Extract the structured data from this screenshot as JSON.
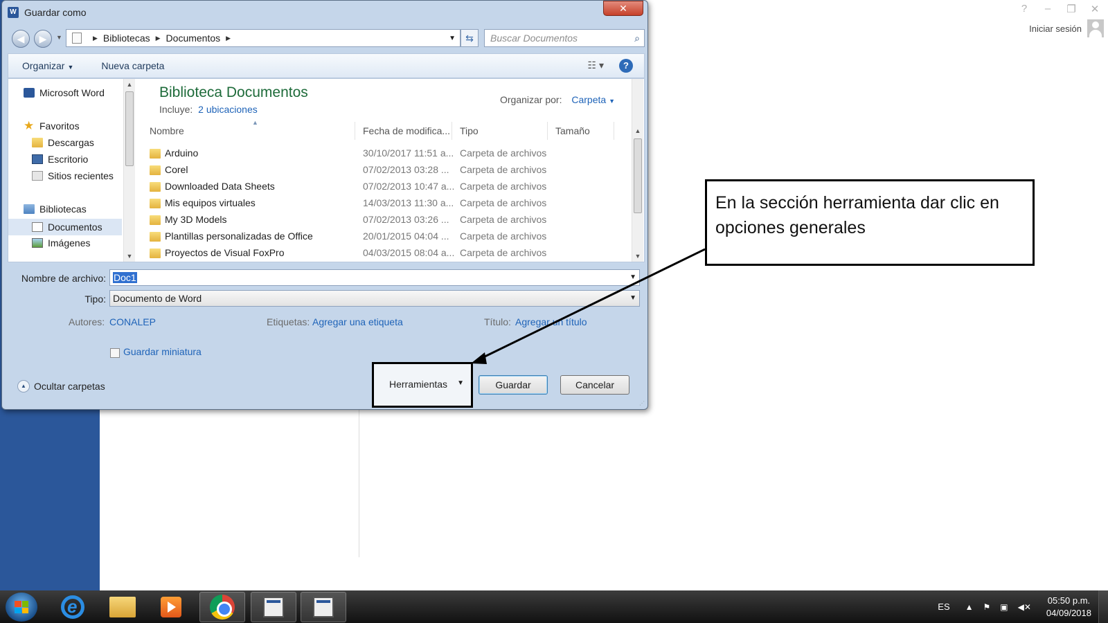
{
  "window": {
    "controls": [
      "?",
      "–",
      "❐",
      "✕"
    ],
    "signin_label": "Iniciar sesión"
  },
  "dialog": {
    "title": "Guardar como",
    "app_icon_letter": "W",
    "close_glyph": "✕",
    "address": {
      "crumbs": [
        "Bibliotecas",
        "Documentos"
      ]
    },
    "search": {
      "placeholder": "Buscar Documentos"
    },
    "toolbar": {
      "organize_label": "Organizar",
      "new_folder_label": "Nueva carpeta",
      "help_glyph": "?"
    },
    "nav_pane": {
      "items": [
        {
          "label": "Microsoft Word",
          "icon": "word-icon"
        },
        {
          "label": "Favoritos",
          "icon": "star-icon"
        },
        {
          "label": "Descargas",
          "icon": "downloads-folder-icon"
        },
        {
          "label": "Escritorio",
          "icon": "desktop-icon"
        },
        {
          "label": "Sitios recientes",
          "icon": "recent-places-icon"
        },
        {
          "label": "Bibliotecas",
          "icon": "libraries-icon"
        },
        {
          "label": "Documentos",
          "icon": "documents-icon",
          "selected": true
        },
        {
          "label": "Imágenes",
          "icon": "pictures-icon"
        }
      ]
    },
    "library": {
      "title": "Biblioteca Documentos",
      "includes_label": "Incluye:",
      "includes_link": "2 ubicaciones",
      "arrange_label": "Organizar por:",
      "arrange_value": "Carpeta"
    },
    "file_list": {
      "columns": [
        "Nombre",
        "Fecha de modifica...",
        "Tipo",
        "Tamaño"
      ],
      "rows": [
        {
          "name": "Arduino",
          "date": "30/10/2017 11:51 a...",
          "type": "Carpeta de archivos"
        },
        {
          "name": "Corel",
          "date": "07/02/2013 03:28 ...",
          "type": "Carpeta de archivos"
        },
        {
          "name": "Downloaded Data Sheets",
          "date": "07/02/2013 10:47 a...",
          "type": "Carpeta de archivos"
        },
        {
          "name": "Mis equipos virtuales",
          "date": "14/03/2013 11:30 a...",
          "type": "Carpeta de archivos"
        },
        {
          "name": "My 3D Models",
          "date": "07/02/2013 03:26 ...",
          "type": "Carpeta de archivos"
        },
        {
          "name": "Plantillas personalizadas de Office",
          "date": "20/01/2015 04:04 ...",
          "type": "Carpeta de archivos"
        },
        {
          "name": "Proyectos de Visual FoxPro",
          "date": "04/03/2015 08:04 a...",
          "type": "Carpeta de archivos"
        }
      ]
    },
    "filename": {
      "label": "Nombre de archivo:",
      "value": "Doc1"
    },
    "filetype": {
      "label": "Tipo:",
      "value": "Documento de Word"
    },
    "meta": {
      "authors_label": "Autores:",
      "authors_value": "CONALEP",
      "tags_label": "Etiquetas:",
      "tags_value": "Agregar una etiqueta",
      "title_label": "Título:",
      "title_value": "Agregar un título"
    },
    "thumbnail_label": "Guardar miniatura",
    "hide_folders_label": "Ocultar carpetas",
    "tools_label": "Herramientas",
    "save_label": "Guardar",
    "cancel_label": "Cancelar"
  },
  "callout": {
    "text": "En la sección herramienta dar clic en opciones generales"
  },
  "taskbar": {
    "apps": [
      "internet-explorer",
      "file-explorer",
      "media-player",
      "chrome",
      "app-window",
      "word-document"
    ],
    "language": "ES",
    "time": "05:50 p.m.",
    "date": "04/09/2018"
  }
}
